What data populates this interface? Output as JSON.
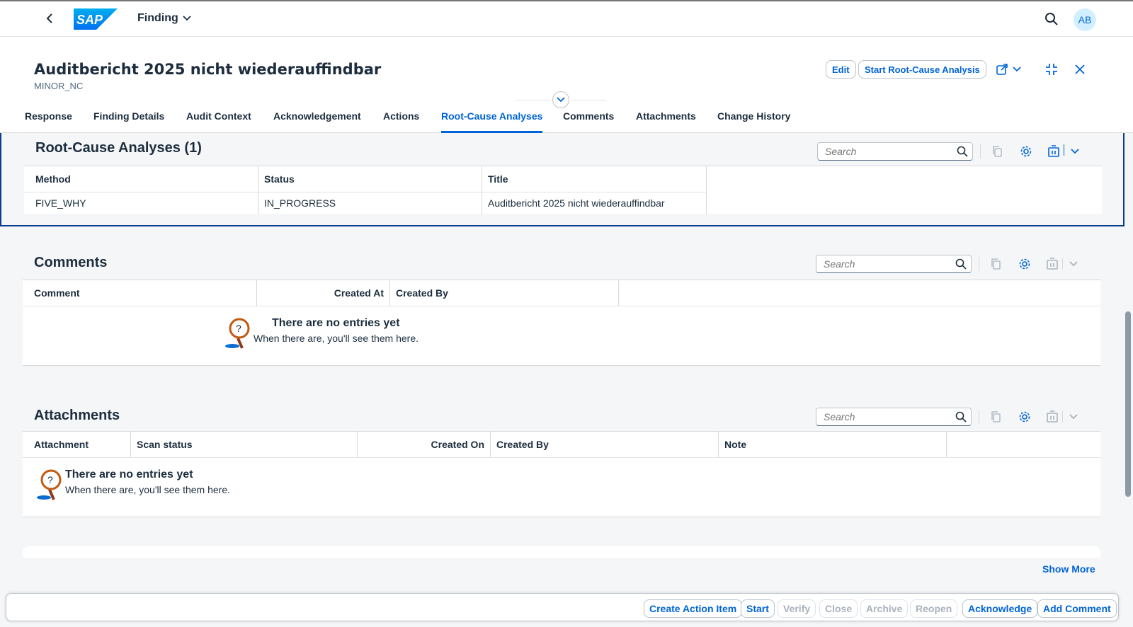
{
  "shell": {
    "app_title": "Finding",
    "logo_text": "SAP",
    "avatar_initials": "AB"
  },
  "header": {
    "title": "Auditbericht 2025 nicht wiederauffindbar",
    "subtitle": "MINOR_NC",
    "edit_label": "Edit",
    "start_rca_label": "Start Root-Cause Analysis"
  },
  "tabs": [
    {
      "label": "Response"
    },
    {
      "label": "Finding Details"
    },
    {
      "label": "Audit Context"
    },
    {
      "label": "Acknowledgement"
    },
    {
      "label": "Actions"
    },
    {
      "label": "Root-Cause Analyses"
    },
    {
      "label": "Comments"
    },
    {
      "label": "Attachments"
    },
    {
      "label": "Change History"
    }
  ],
  "rca": {
    "title": "Root-Cause Analyses (1)",
    "search_placeholder": "Search",
    "columns": [
      "Method",
      "Status",
      "Title"
    ],
    "rows": [
      {
        "method": "FIVE_WHY",
        "status": "IN_PROGRESS",
        "title": "Auditbericht 2025 nicht wiederauffindbar"
      }
    ]
  },
  "comments": {
    "title": "Comments",
    "search_placeholder": "Search",
    "columns": [
      "Comment",
      "Created At",
      "Created By"
    ],
    "empty_title": "There are no entries yet",
    "empty_sub": "When there are, you'll see them here."
  },
  "attachments": {
    "title": "Attachments",
    "search_placeholder": "Search",
    "columns": [
      "Attachment",
      "Scan status",
      "Created On",
      "Created By",
      "Note"
    ],
    "empty_title": "There are no entries yet",
    "empty_sub": "When there are, you'll see them here."
  },
  "show_more": "Show More",
  "footer": {
    "buttons": [
      {
        "label": "Create Action Item",
        "enabled": true
      },
      {
        "label": "Start",
        "enabled": true
      },
      {
        "label": "Verify",
        "enabled": false
      },
      {
        "label": "Close",
        "enabled": false
      },
      {
        "label": "Archive",
        "enabled": false
      },
      {
        "label": "Reopen",
        "enabled": false
      },
      {
        "label": "Acknowledge",
        "enabled": true
      },
      {
        "label": "Add Comment",
        "enabled": true
      }
    ]
  },
  "colors": {
    "accent": "#0064d9",
    "text": "#1d2d3e",
    "highlight_border": "#0a3d8f"
  }
}
